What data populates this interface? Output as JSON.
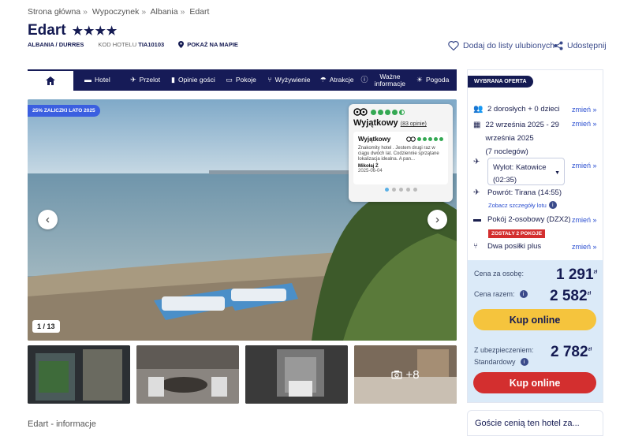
{
  "breadcrumb": [
    "Strona główna",
    "Wypoczynek",
    "Albania",
    "Edart"
  ],
  "hotel": {
    "name": "Edart",
    "stars": "★★★★",
    "location": "ALBANIA / DURRES",
    "code_label": "KOD HOTELU",
    "code": "TIA10103",
    "map_link": "POKAŻ NA MAPIE"
  },
  "actions": {
    "favorite": "Dodaj do listy ulubionych",
    "share": "Udostępnij"
  },
  "tabs": [
    {
      "label": "",
      "icon": "home-icon"
    },
    {
      "label": "Hotel",
      "icon": "bed-icon"
    },
    {
      "label": "Przelot",
      "icon": "plane-icon"
    },
    {
      "label": "Opinie gości",
      "icon": "chat-icon"
    },
    {
      "label": "Pokoje",
      "icon": "car-icon"
    },
    {
      "label": "Wyżywienie",
      "icon": "cutlery-icon"
    },
    {
      "label": "Atrakcje",
      "icon": "umbrella-icon"
    },
    {
      "label": "Ważne informacje",
      "icon": "info-icon"
    },
    {
      "label": "Pogoda",
      "icon": "sun-icon"
    }
  ],
  "gallery": {
    "promo": "25% ZALICZKI LATO 2025",
    "counter": "1 / 13",
    "more": "+8"
  },
  "tripadvisor": {
    "rating_label": "Wyjątkowy",
    "reviews": "83 opinie",
    "score": 4.5,
    "review": {
      "title": "Wyjątkowy",
      "text": "Znakomity hotel . Jestem drugi raz w ciągu dwóch lat. Codziennie sprzątane lokalizacja idealna. A pan...",
      "author": "Mikołaj Ż",
      "date": "2025-06-04"
    }
  },
  "info_title": "Edart - informacje",
  "offer": {
    "label": "WYBRANA OFERTA",
    "guests": "2 dorosłych + 0 dzieci",
    "dates": "22 września 2025 - 29 września 2025",
    "nights": "(7 noclegów)",
    "departure": "Wylot: Katowice (02:35)",
    "return": "Powrót: Tirana (14:55)",
    "flight_details": "Zobacz szczegóły lotu",
    "room": "Pokój 2-osobowy (DZX2)",
    "room_badge": "ZOSTAŁY 2 POKOJE",
    "board": "Dwa posiłki plus",
    "change": "zmień »",
    "price_person_label": "Cena za osobę:",
    "price_person": "1 291",
    "price_total_label": "Cena razem:",
    "price_total": "2 582",
    "currency": "zł",
    "buy": "Kup online",
    "insurance_label": "Z ubezpieczeniem:",
    "insurance_type": "Standardowy",
    "price_insured": "2 782"
  },
  "guests_section": "Goście cenią ten hotel za..."
}
